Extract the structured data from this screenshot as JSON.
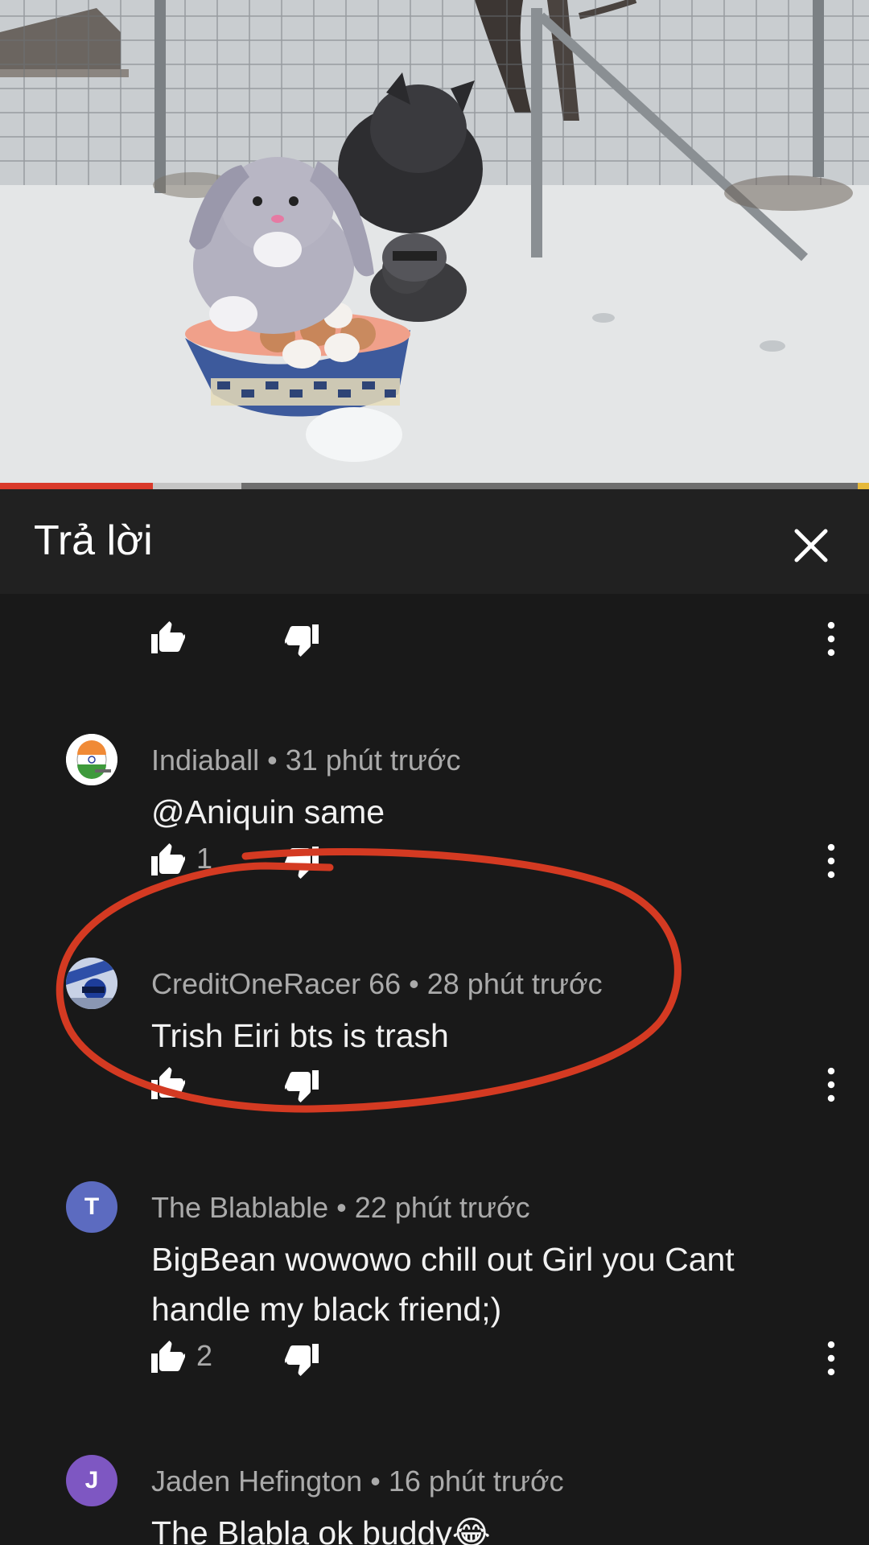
{
  "header": {
    "title": "Trả lời"
  },
  "comments": [
    {
      "author": "Indiaball",
      "time": "31 phút trước",
      "text": "@Aniquin same",
      "likes": "1"
    },
    {
      "author": "CreditOneRacer 66",
      "time": "28 phút trước",
      "text": "Trish Eiri bts is trash",
      "likes": ""
    },
    {
      "author": "The Blablable",
      "time": "22 phút trước",
      "text": "BigBean wowowo chill out Girl you Cant handle my black friend;)",
      "likes": "2",
      "avatar_letter": "T",
      "avatar_color": "#5c6bc0"
    },
    {
      "author": "Jaden Hefington",
      "time": "16 phút trước",
      "text": "The Blabla ok buddy😂",
      "likes": "",
      "avatar_letter": "J",
      "avatar_color": "#7e57c2"
    }
  ],
  "colors": {
    "progress_played": "#d93a2b",
    "annotation_circle": "#d43a22",
    "background": "#212121",
    "meta_text": "#aaaaaa"
  },
  "icons": [
    "like-icon",
    "dislike-icon",
    "more-vert-icon",
    "close-icon"
  ]
}
